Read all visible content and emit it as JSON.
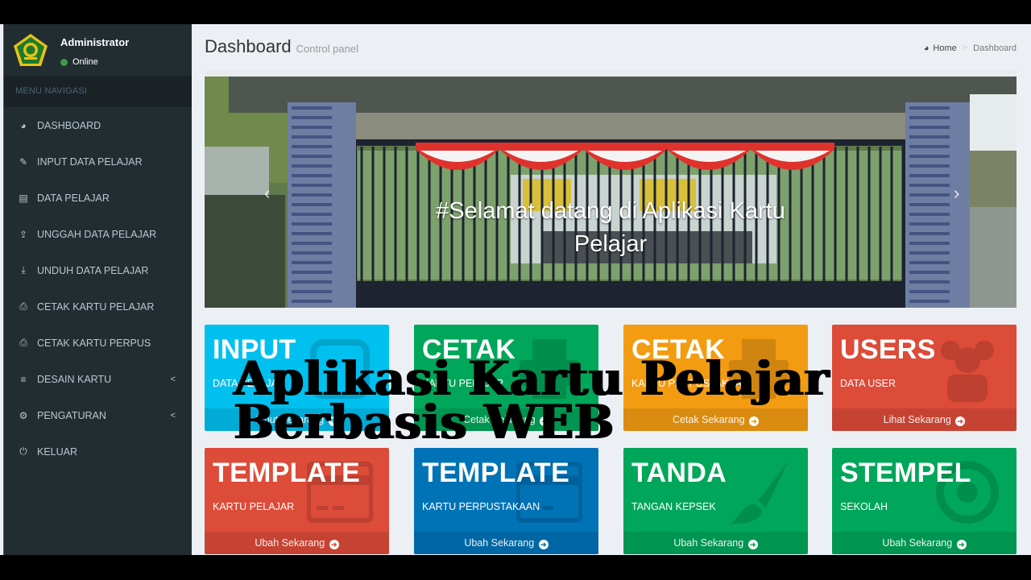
{
  "sidebar": {
    "user": {
      "name": "Administrator",
      "status": "Online",
      "status_color": "#3c9a4a"
    },
    "menu_header": "MENU NAVIGASI",
    "items": [
      {
        "label": "DASHBOARD",
        "icon": "dashboard-icon",
        "glyph": "◕"
      },
      {
        "label": "INPUT DATA PELAJAR",
        "icon": "edit-icon",
        "glyph": "✎"
      },
      {
        "label": "DATA PELAJAR",
        "icon": "book-icon",
        "glyph": "▤"
      },
      {
        "label": "UNGGAH DATA PELAJAR",
        "icon": "upload-icon",
        "glyph": "⇪"
      },
      {
        "label": "UNDUH DATA PELAJAR",
        "icon": "download-icon",
        "glyph": "⤓"
      },
      {
        "label": "CETAK KARTU PELAJAR",
        "icon": "print-icon",
        "glyph": "⎙"
      },
      {
        "label": "CETAK KARTU PERPUS",
        "icon": "print-icon",
        "glyph": "⎙"
      },
      {
        "label": "DESAIN KARTU",
        "icon": "bars-icon",
        "glyph": "≡",
        "chevron": "<"
      },
      {
        "label": "PENGATURAN",
        "icon": "gears-icon",
        "glyph": "⚙",
        "chevron": "<"
      },
      {
        "label": "KELUAR",
        "icon": "power-icon",
        "glyph": "⏻"
      }
    ]
  },
  "header": {
    "title": "Dashboard",
    "subtitle": "Control panel",
    "breadcrumb": {
      "home": "Home",
      "separator": ">",
      "current": "Dashboard"
    }
  },
  "carousel": {
    "caption_line1": "#Selamat datang di Aplikasi Kartu",
    "caption_line2": "Pelajar",
    "slides": 2,
    "active_slide": 1,
    "prev": "‹",
    "next": "›"
  },
  "tiles": [
    {
      "title": "INPUT",
      "subtitle": "DATA PELAJAR",
      "footer": "Input Sekarang",
      "footer_icon": "✎",
      "color": "#00c0ef",
      "icon": "edit-icon"
    },
    {
      "title": "CETAK",
      "subtitle": "KARTU PELAJAR",
      "footer": "Cetak Sekarang",
      "footer_icon": "➜",
      "color": "#00a65a",
      "icon": "print-icon"
    },
    {
      "title": "CETAK",
      "subtitle": "KARTU PERPUSTAKAAN",
      "footer": "Cetak Sekarang",
      "footer_icon": "➜",
      "color": "#f39c12",
      "icon": "print-icon"
    },
    {
      "title": "USERS",
      "subtitle": "DATA USER",
      "footer": "Lihat Sekarang",
      "footer_icon": "➜",
      "color": "#dd4b39",
      "icon": "users-icon"
    },
    {
      "title": "TEMPLATE",
      "subtitle": "KARTU PELAJAR",
      "footer": "Ubah Sekarang",
      "footer_icon": "➜",
      "color": "#dd4b39",
      "icon": "credit-card-icon"
    },
    {
      "title": "TEMPLATE",
      "subtitle": "KARTU PERPUSTAKAAN",
      "footer": "Ubah Sekarang",
      "footer_icon": "➜",
      "color": "#0073b7",
      "icon": "credit-card-icon"
    },
    {
      "title": "TANDA",
      "subtitle": "TANGAN KEPSEK",
      "footer": "Ubah Sekarang",
      "footer_icon": "➜",
      "color": "#00a65a",
      "icon": "paint-brush-icon"
    },
    {
      "title": "STEMPEL",
      "subtitle": "SEKOLAH",
      "footer": "Ubah Sekarang",
      "footer_icon": "➜",
      "color": "#00a65a",
      "icon": "dot-circle-icon"
    }
  ],
  "overlay_title": {
    "line1": "Aplikasi Kartu Pelajar",
    "line2": "Berbasis WEB"
  }
}
